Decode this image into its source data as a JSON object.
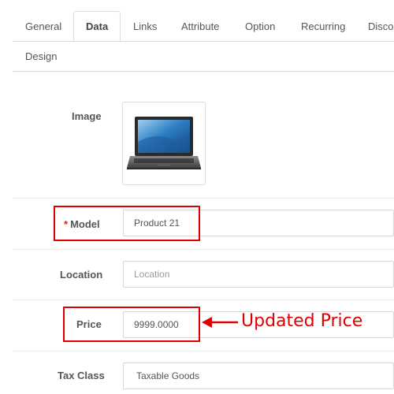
{
  "tabs": [
    {
      "label": "General"
    },
    {
      "label": "Data",
      "active": true
    },
    {
      "label": "Links"
    },
    {
      "label": "Attribute"
    },
    {
      "label": "Option"
    },
    {
      "label": "Recurring"
    },
    {
      "label": "Discou"
    },
    {
      "label": "Design"
    }
  ],
  "form": {
    "image_label": "Image",
    "model": {
      "required_mark": "*",
      "label": "Model",
      "value": "Product 21"
    },
    "location": {
      "label": "Location",
      "placeholder": "Location"
    },
    "price": {
      "label": "Price",
      "value": "9999.0000"
    },
    "tax_class": {
      "label": "Tax Class",
      "value": "Taxable Goods"
    }
  },
  "annotation": {
    "text": "Updated Price",
    "color": "#e00000"
  },
  "colors": {
    "highlight": "#e00000",
    "border": "#dddddd"
  }
}
